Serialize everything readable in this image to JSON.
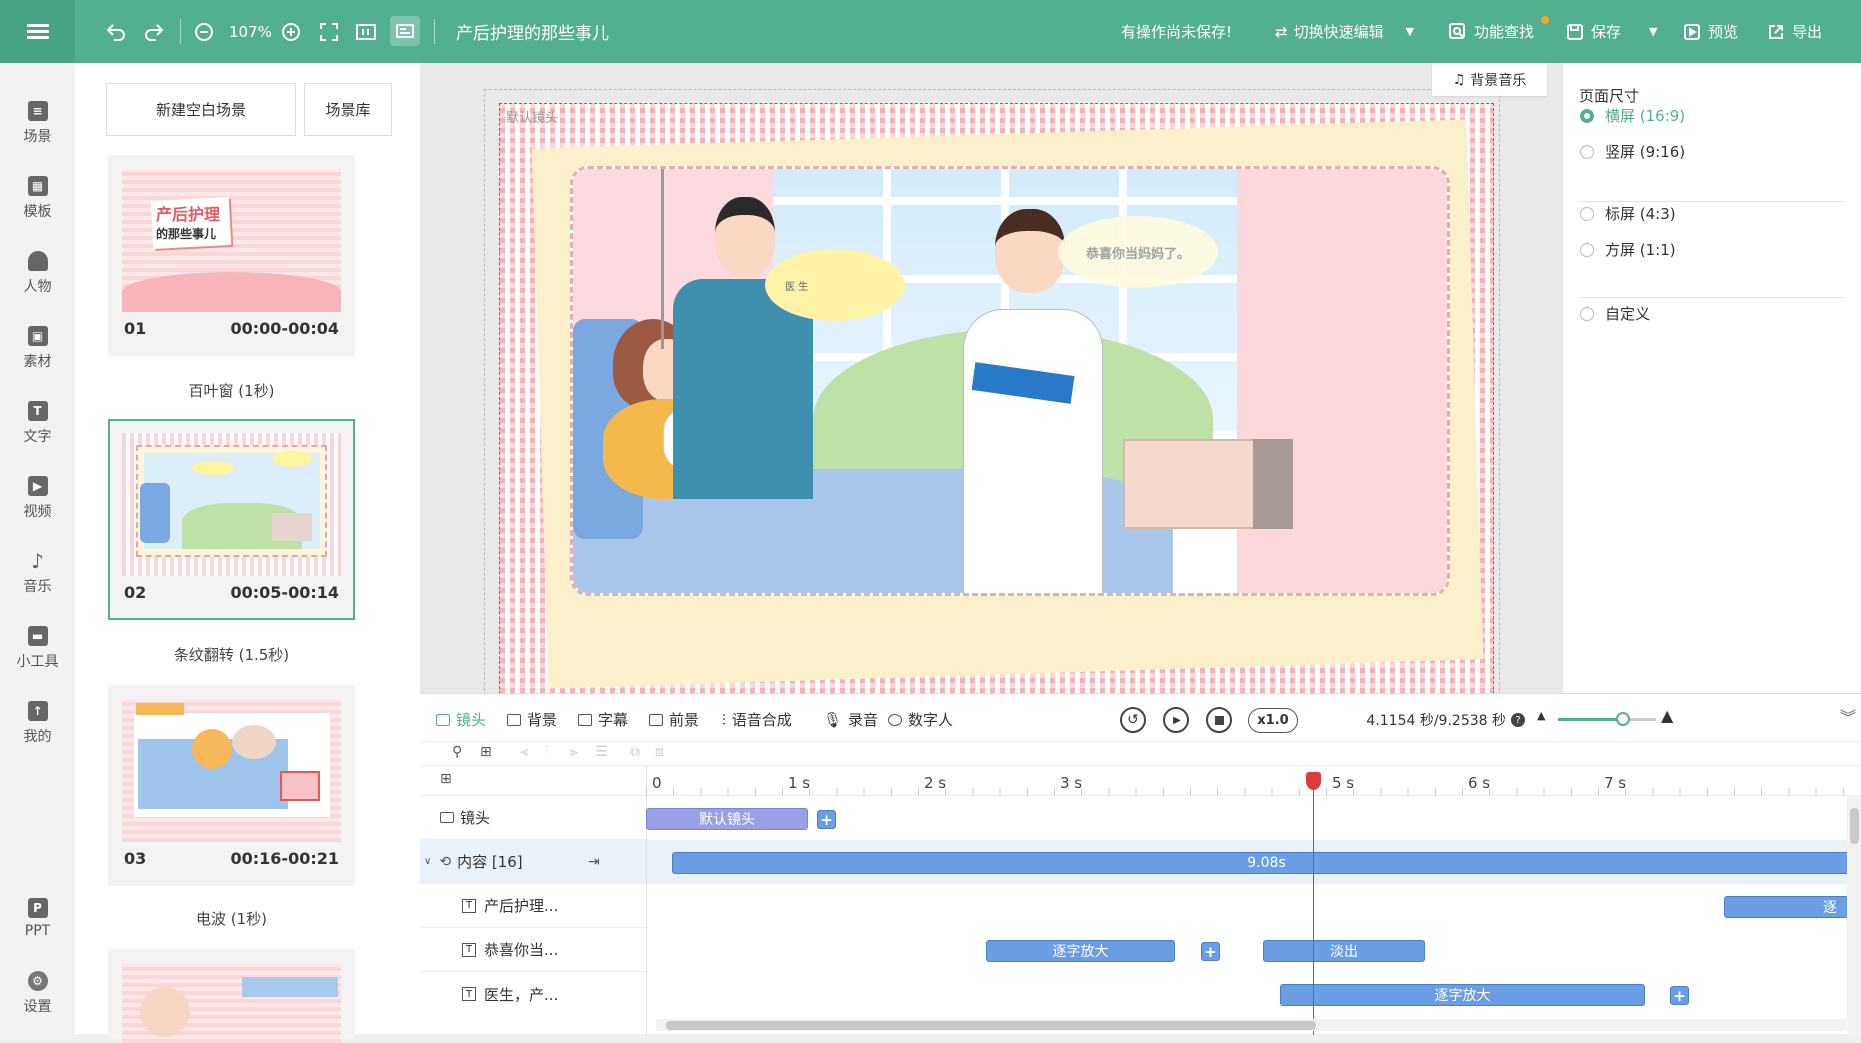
{
  "topbar": {
    "zoom": "107%",
    "project_title": "产后护理的那些事儿",
    "unsaved_notice": "有操作尚未保存!",
    "switch_label": "切换快速编辑",
    "find_label": "功能查找",
    "save_label": "保存",
    "preview_label": "预览",
    "export_label": "导出"
  },
  "nav": {
    "items": [
      "场景",
      "模板",
      "人物",
      "素材",
      "文字",
      "视频",
      "音乐",
      "小工具",
      "我的"
    ],
    "ppt": "PPT",
    "settings": "设置"
  },
  "scenes": {
    "new_blank": "新建空白场景",
    "library": "场景库",
    "cards": [
      {
        "num": "01",
        "time": "00:00-00:04",
        "thumb_line1": "产后护理",
        "thumb_line2": "的那些事儿"
      },
      {
        "num": "02",
        "time": "00:05-00:14"
      },
      {
        "num": "03",
        "time": "00:16-00:21"
      }
    ],
    "transitions": [
      "百叶窗 (1秒)",
      "条纹翻转 (1.5秒)",
      "电波 (1秒)"
    ]
  },
  "canvas": {
    "lens_label": "默认镜头",
    "bg_music": "背景音乐",
    "bubble_left": "医 生",
    "bubble_right": "恭喜你当妈妈了。"
  },
  "props": {
    "title": "页面尺寸",
    "options": [
      "横屏 (16:9)",
      "竖屏 (9:16)",
      "标屏 (4:3)",
      "方屏 (1:1)",
      "自定义"
    ],
    "selected": "横屏 (16:9)"
  },
  "timeline": {
    "tabs": [
      "镜头",
      "背景",
      "字幕",
      "前景",
      "语音合成",
      "录音",
      "数字人"
    ],
    "speed": "x1.0",
    "time_readout": "4.1154 秒/9.2538 秒",
    "ruler": [
      "0",
      "1 s",
      "2 s",
      "3 s",
      "4 s",
      "5 s",
      "6 s",
      "7 s"
    ],
    "tracks": {
      "lens": "镜头",
      "content": "内容 [16]",
      "text1": "产后护理...",
      "text2": "恭喜你当...",
      "text3": "医生，产..."
    },
    "clips": {
      "default_lens": "默认镜头",
      "content_duration": "9.08s",
      "text1_clip": "逐",
      "text2_a": "逐字放大",
      "text2_b": "淡出",
      "text3_a": "逐字放大"
    },
    "plus": "+"
  }
}
